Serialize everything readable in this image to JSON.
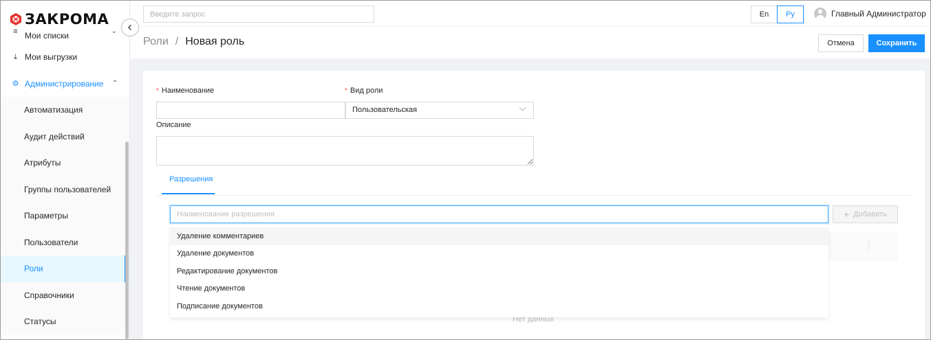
{
  "brand": {
    "name": "ЗАКРОМА"
  },
  "sidebar": {
    "items": [
      {
        "label": "Мои списки",
        "icon": "list-icon"
      },
      {
        "label": "Мои выгрузки",
        "icon": "download-icon"
      },
      {
        "label": "Администрирование",
        "icon": "gear-icon"
      }
    ],
    "admin_submenu": [
      {
        "label": "Автоматизация"
      },
      {
        "label": "Аудит действий"
      },
      {
        "label": "Атрибуты"
      },
      {
        "label": "Группы пользователей"
      },
      {
        "label": "Параметры"
      },
      {
        "label": "Пользователи"
      },
      {
        "label": "Роли",
        "active": true
      },
      {
        "label": "Справочники"
      },
      {
        "label": "Статусы"
      }
    ]
  },
  "topbar": {
    "search_placeholder": "Введите запрос",
    "lang_en": "En",
    "lang_ru": "Ру",
    "user_name": "Главный Администратор"
  },
  "header": {
    "breadcrumb_parent": "Роли",
    "breadcrumb_separator": "/",
    "title": "Новая роль",
    "cancel_label": "Отмена",
    "save_label": "Сохранить"
  },
  "form": {
    "name_label": "Наименование",
    "name_value": "",
    "role_type_label": "Вид роли",
    "role_type_value": "Пользовательская",
    "description_label": "Описание",
    "description_value": "",
    "required_mark": "*"
  },
  "tabs": [
    {
      "label": "Разрешения",
      "active": true
    }
  ],
  "permissions": {
    "input_placeholder": "Наименование разрешения",
    "add_label": "Добавить",
    "empty_text": "Нет данных",
    "suggestions": [
      "Удаление комментариев",
      "Удаление документов",
      "Редактирование документов",
      "Чтение документов",
      "Подписание документов"
    ]
  },
  "colors": {
    "accent": "#1890ff",
    "required": "#ff4d4f",
    "background": "#f0f2f5"
  }
}
